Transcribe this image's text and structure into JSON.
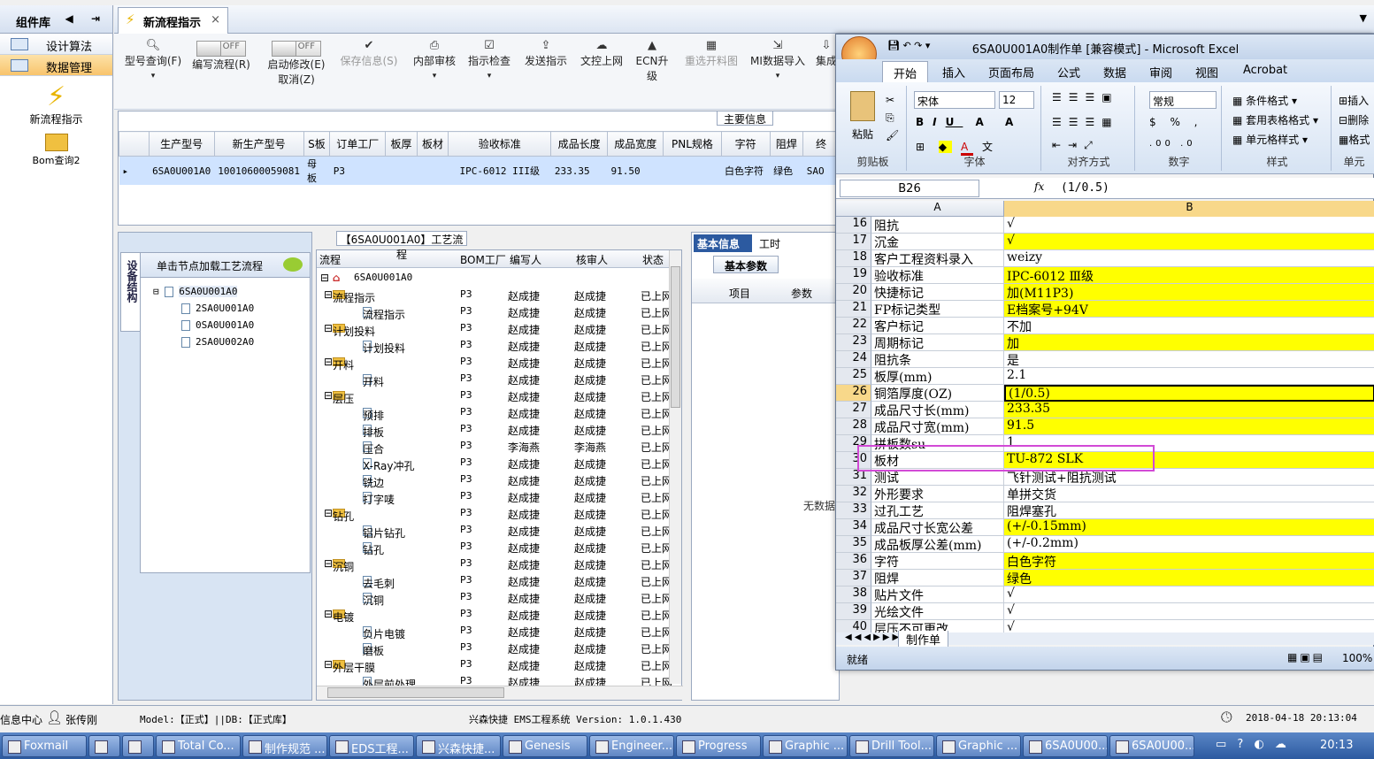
{
  "sidebar": {
    "title": "组件库",
    "items": [
      "设计算法",
      "数据管理"
    ],
    "big": [
      "新流程指示",
      "Bom查询2"
    ]
  },
  "tab": {
    "label": "新流程指示",
    "close": "×"
  },
  "toolbar": {
    "query": "型号查询(F)",
    "write": "编写流程(R)",
    "start": "启动修改(E)",
    "cancel": "取消(Z)",
    "toggle_off": "OFF",
    "save": "保存信息(S)",
    "audit": "内部审核",
    "check": "指示检查",
    "send": "发送指示",
    "upload": "文控上网",
    "ecn": "ECN升级",
    "reselect": "重选开料图",
    "mi": "MI数据导入",
    "more": "集成"
  },
  "main_label": "主要信息",
  "grid": {
    "headers": [
      "生产型号",
      "新生产型号",
      "S板",
      "订单工厂",
      "板厚",
      "板材",
      "验收标准",
      "成品长度",
      "成品宽度",
      "PNL规格",
      "字符",
      "阻焊",
      "终"
    ],
    "row": [
      "6SA0U001A0",
      "10010600059081",
      "母板",
      "P3",
      "",
      "",
      "IPC-6012 III级",
      "233.35",
      "91.50",
      "",
      "白色字符",
      "绿色",
      "SAO"
    ]
  },
  "process": {
    "title": "【6SA0U001A0】工艺流程",
    "vtab": "设备结构",
    "load_hint": "单击节点加载工艺流程",
    "tree": [
      "6SA0U001A0",
      "2SA0U001A0",
      "0SA0U001A0",
      "2SA0U002A0"
    ],
    "cols": [
      "流程",
      "BOM工厂",
      "编写人",
      "核审人",
      "状态"
    ],
    "root": "6SA0U001A0",
    "rows": [
      {
        "t": "f",
        "n": "流程指示",
        "p": "P3",
        "w": "赵成捷",
        "r": "赵成捷",
        "s": "已上网"
      },
      {
        "t": "d",
        "n": "流程指示",
        "p": "P3",
        "w": "赵成捷",
        "r": "赵成捷",
        "s": "已上网"
      },
      {
        "t": "f",
        "n": "计划投料",
        "p": "P3",
        "w": "赵成捷",
        "r": "赵成捷",
        "s": "已上网"
      },
      {
        "t": "d",
        "n": "计划投料",
        "p": "P3",
        "w": "赵成捷",
        "r": "赵成捷",
        "s": "已上网"
      },
      {
        "t": "f",
        "n": "开料",
        "p": "P3",
        "w": "赵成捷",
        "r": "赵成捷",
        "s": "已上网"
      },
      {
        "t": "d",
        "n": "开料",
        "p": "P3",
        "w": "赵成捷",
        "r": "赵成捷",
        "s": "已上网"
      },
      {
        "t": "f",
        "n": "层压",
        "p": "P3",
        "w": "赵成捷",
        "r": "赵成捷",
        "s": "已上网"
      },
      {
        "t": "d",
        "n": "预排",
        "p": "P3",
        "w": "赵成捷",
        "r": "赵成捷",
        "s": "已上网"
      },
      {
        "t": "d",
        "n": "排板",
        "p": "P3",
        "w": "赵成捷",
        "r": "赵成捷",
        "s": "已上网"
      },
      {
        "t": "d",
        "n": "压合",
        "p": "P3",
        "w": "李海燕",
        "r": "李海燕",
        "s": "已上网"
      },
      {
        "t": "d",
        "n": "X-Ray冲孔",
        "p": "P3",
        "w": "赵成捷",
        "r": "赵成捷",
        "s": "已上网"
      },
      {
        "t": "d",
        "n": "铣边",
        "p": "P3",
        "w": "赵成捷",
        "r": "赵成捷",
        "s": "已上网"
      },
      {
        "t": "d",
        "n": "打字唛",
        "p": "P3",
        "w": "赵成捷",
        "r": "赵成捷",
        "s": "已上网"
      },
      {
        "t": "f",
        "n": "钻孔",
        "p": "P3",
        "w": "赵成捷",
        "r": "赵成捷",
        "s": "已上网"
      },
      {
        "t": "d",
        "n": "铝片钻孔",
        "p": "P3",
        "w": "赵成捷",
        "r": "赵成捷",
        "s": "已上网"
      },
      {
        "t": "d",
        "n": "钻孔",
        "p": "P3",
        "w": "赵成捷",
        "r": "赵成捷",
        "s": "已上网"
      },
      {
        "t": "f",
        "n": "沉铜",
        "p": "P3",
        "w": "赵成捷",
        "r": "赵成捷",
        "s": "已上网"
      },
      {
        "t": "d",
        "n": "去毛刺",
        "p": "P3",
        "w": "赵成捷",
        "r": "赵成捷",
        "s": "已上网"
      },
      {
        "t": "d",
        "n": "沉铜",
        "p": "P3",
        "w": "赵成捷",
        "r": "赵成捷",
        "s": "已上网"
      },
      {
        "t": "f",
        "n": "电镀",
        "p": "P3",
        "w": "赵成捷",
        "r": "赵成捷",
        "s": "已上网"
      },
      {
        "t": "d",
        "n": "负片电镀",
        "p": "P3",
        "w": "赵成捷",
        "r": "赵成捷",
        "s": "已上网"
      },
      {
        "t": "d",
        "n": "磨板",
        "p": "P3",
        "w": "赵成捷",
        "r": "赵成捷",
        "s": "已上网"
      },
      {
        "t": "f",
        "n": "外层干膜",
        "p": "P3",
        "w": "赵成捷",
        "r": "赵成捷",
        "s": "已上网"
      },
      {
        "t": "d",
        "n": "外层前处理",
        "p": "P3",
        "w": "赵成捷",
        "r": "赵成捷",
        "s": "已上网"
      }
    ]
  },
  "info": {
    "tab1": "基本信息",
    "tab2": "工时",
    "sub": "基本参数",
    "col1": "项目",
    "col2": "参数",
    "empty": "无数据"
  },
  "excel": {
    "title": "6SA0U001A0制作单  [兼容模式] - Microsoft Excel",
    "tabs": [
      "开始",
      "插入",
      "页面布局",
      "公式",
      "数据",
      "审阅",
      "视图",
      "Acrobat"
    ],
    "groups": [
      "剪贴板",
      "字体",
      "对齐方式",
      "数字",
      "样式",
      "单元"
    ],
    "paste": "粘贴",
    "font": "宋体",
    "font_size": "12",
    "number_format": "常规",
    "style_items": [
      "条件格式",
      "套用表格格式",
      "单元格样式"
    ],
    "cell_items": [
      "插入",
      "删除",
      "格式"
    ],
    "cell_ref": "B26",
    "formula": "(1/0.5)",
    "col_a": "A",
    "col_b": "B",
    "rows": [
      {
        "n": "16",
        "a": "阻抗",
        "b": "√",
        "y": false
      },
      {
        "n": "17",
        "a": "沉金",
        "b": "√",
        "y": true
      },
      {
        "n": "18",
        "a": "客户工程资料录入",
        "b": "weizy",
        "y": false
      },
      {
        "n": "19",
        "a": "验收标准",
        "b": "IPC-6012 Ⅲ级",
        "y": true
      },
      {
        "n": "20",
        "a": "快捷标记",
        "b": "加(M11P3)",
        "y": true
      },
      {
        "n": "21",
        "a": "FP标记类型",
        "b": "E档案号+94V",
        "y": true
      },
      {
        "n": "22",
        "a": "客户标记",
        "b": "不加",
        "y": false
      },
      {
        "n": "23",
        "a": "周期标记",
        "b": "加",
        "y": true
      },
      {
        "n": "24",
        "a": "阻抗条",
        "b": "是",
        "y": false
      },
      {
        "n": "25",
        "a": "板厚(mm)",
        "b": "2.1",
        "y": false
      },
      {
        "n": "26",
        "a": "铜箔厚度(OZ)",
        "b": "(1/0.5)",
        "y": true
      },
      {
        "n": "27",
        "a": "成品尺寸长(mm)",
        "b": "233.35",
        "y": true
      },
      {
        "n": "28",
        "a": "成品尺寸宽(mm)",
        "b": "91.5",
        "y": true
      },
      {
        "n": "29",
        "a": "拼板数su",
        "b": "1",
        "y": false
      },
      {
        "n": "30",
        "a": "板材",
        "b": "TU-872 SLK",
        "y": true
      },
      {
        "n": "31",
        "a": "测试",
        "b": "飞针测试+阻抗测试",
        "y": false
      },
      {
        "n": "32",
        "a": "外形要求",
        "b": "单拼交货",
        "y": false
      },
      {
        "n": "33",
        "a": "过孔工艺",
        "b": "阻焊塞孔",
        "y": false
      },
      {
        "n": "34",
        "a": "成品尺寸长宽公差",
        "b": "(+/-0.15mm)",
        "y": true
      },
      {
        "n": "35",
        "a": "成品板厚公差(mm)",
        "b": "(+/-0.2mm)",
        "y": false
      },
      {
        "n": "36",
        "a": "字符",
        "b": "白色字符",
        "y": true
      },
      {
        "n": "37",
        "a": "阻焊",
        "b": "绿色",
        "y": true
      },
      {
        "n": "38",
        "a": "贴片文件",
        "b": "√",
        "y": false
      },
      {
        "n": "39",
        "a": "光绘文件",
        "b": "√",
        "y": false
      },
      {
        "n": "40",
        "a": "层压不可更改",
        "b": "√",
        "y": false
      }
    ],
    "sheet_tab": "制作单",
    "status": "就绪",
    "zoom": "100%"
  },
  "status": {
    "left": "信息中心",
    "user": "张传刚",
    "model": "Model:【正式】||DB:【正式库】",
    "app": "兴森快捷 EMS工程系统 Version: 1.0.1.430",
    "time": "2018-04-18 20:13:04"
  },
  "taskbar": {
    "items": [
      "Foxmail",
      "",
      "",
      "Total Co...",
      "制作规范 ...",
      "EDS工程...",
      "兴森快捷...",
      "Genesis",
      "Engineer...",
      "Progress",
      "Graphic ...",
      "Drill Tool...",
      "Graphic ...",
      "6SA0U00...",
      "6SA0U00..."
    ],
    "clock": "20:13"
  },
  "colors": {
    "highlight": "#ffff00",
    "accent_box": "#d24ad6",
    "selected_row": "#cfe3ff"
  }
}
